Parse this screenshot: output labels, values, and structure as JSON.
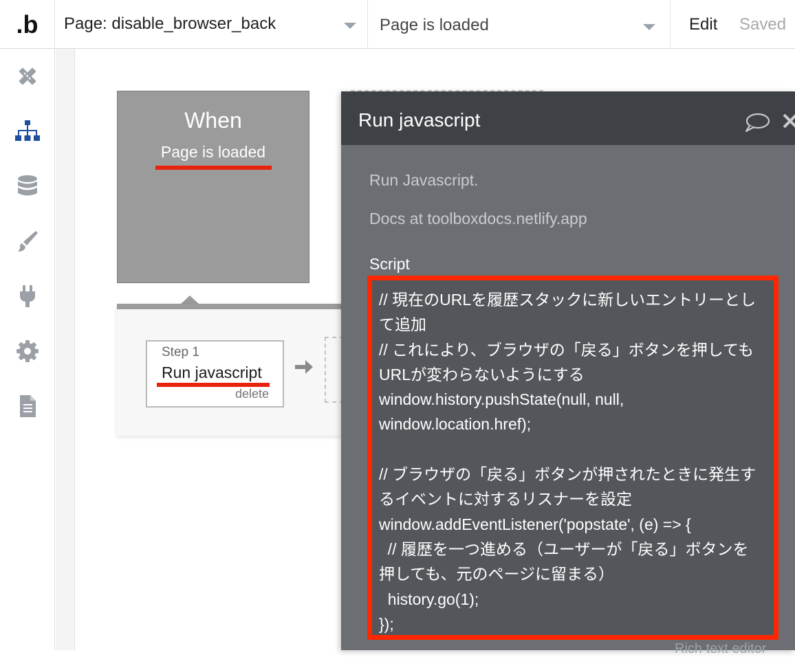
{
  "topbar": {
    "logo": ".b",
    "page_label": "Page: disable_browser_back",
    "event_label": "Page is loaded",
    "edit_label": "Edit",
    "saved_label": "Saved"
  },
  "sidebar": {
    "items": [
      {
        "icon": "design-icon"
      },
      {
        "icon": "workflow-icon",
        "active": true
      },
      {
        "icon": "database-icon"
      },
      {
        "icon": "styles-icon"
      },
      {
        "icon": "plugins-icon"
      },
      {
        "icon": "settings-icon"
      },
      {
        "icon": "logs-icon"
      }
    ]
  },
  "when_block": {
    "title": "When",
    "event": "Page is loaded"
  },
  "step": {
    "number": "Step 1",
    "name": "Run javascript",
    "delete_label": "delete"
  },
  "panel": {
    "title": "Run javascript",
    "description": "Run Javascript.",
    "docs": "Docs at toolboxdocs.netlify.app",
    "script_label": "Script",
    "script_lines": [
      "// 現在のURLを履歴スタックに新しいエントリーとし",
      "て追加",
      "// これにより、ブラウザの「戻る」ボタンを押しても",
      "URLが変わらないようにする",
      "window.history.pushState(null, null,",
      "window.location.href);",
      "",
      "// ブラウザの「戻る」ボタンが押されたときに発生す",
      "るイベントに対するリスナーを設定",
      "window.addEventListener('popstate', (e) => {",
      "  // 履歴を一つ進める（ユーザーが「戻る」ボタンを",
      "押しても、元のページに留まる）",
      "  history.go(1);",
      "});"
    ],
    "rich_text_label": "Rich text editor"
  },
  "colors": {
    "highlight": "#e8220b",
    "panel_header": "#3e4246",
    "panel_body": "#6b6e72",
    "active_icon": "#1f4e9c",
    "inactive_icon": "#9aa0a6"
  }
}
